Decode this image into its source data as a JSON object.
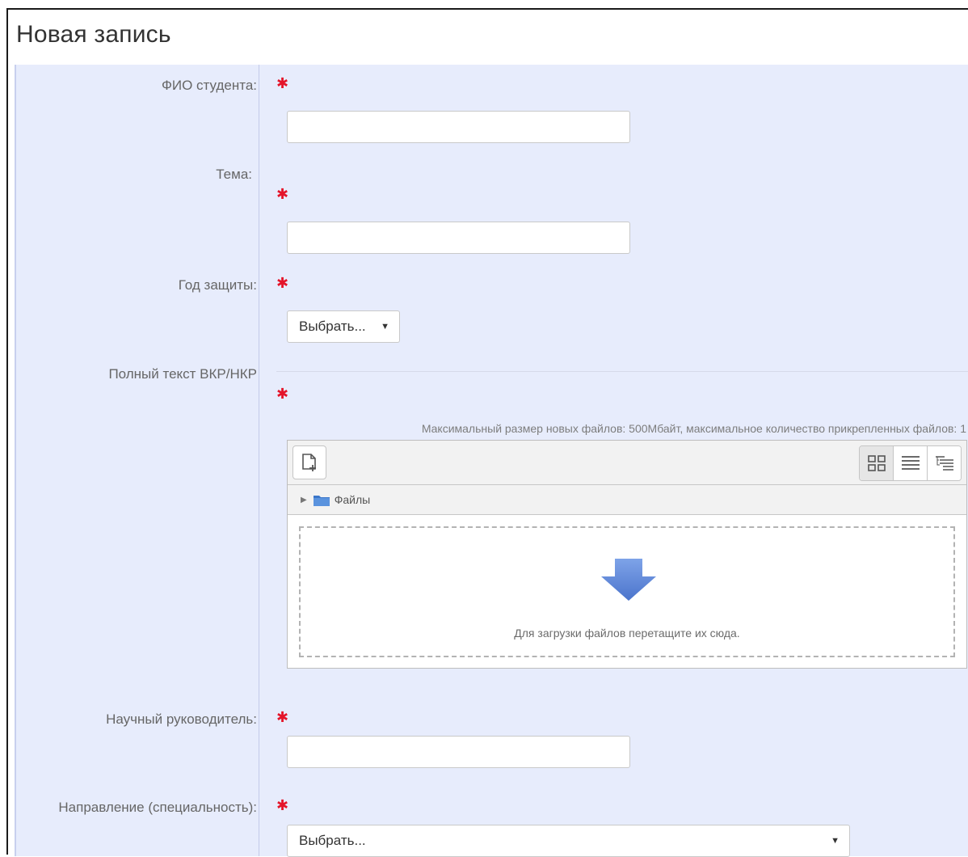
{
  "page": {
    "title": "Новая запись"
  },
  "fields": {
    "student_name": {
      "label": "ФИО студента:",
      "required_mark": "✱",
      "value": ""
    },
    "topic": {
      "label": "Тема:",
      "required_mark": "✱",
      "value": ""
    },
    "defense_year": {
      "label": "Год защиты:",
      "required_mark": "✱",
      "selected": "Выбрать..."
    },
    "full_text": {
      "label": "Полный текст ВКР/НКР",
      "required_mark": "✱",
      "max_info": "Максимальный размер новых файлов: 500Мбайт, максимальное количество прикрепленных файлов: 1",
      "path_label": "Файлы",
      "drop_text": "Для загрузки файлов перетащите их сюда."
    },
    "supervisor": {
      "label": "Научный руководитель:",
      "required_mark": "✱",
      "value": ""
    },
    "direction": {
      "label": "Направление (специальность):",
      "required_mark": "✱",
      "selected": "Выбрать..."
    }
  },
  "icons": {
    "add_file": "add-file-icon",
    "view_icons": "grid-view-icon",
    "view_list": "list-view-icon",
    "view_tree": "tree-view-icon",
    "folder": "folder-icon",
    "drop_arrow": "down-arrow-icon",
    "select_arrow": "▼",
    "path_toggle": "▶"
  },
  "colors": {
    "required": "#e4152a",
    "form_background": "#e7ecfc",
    "drop_arrow": "#5b84d8"
  }
}
